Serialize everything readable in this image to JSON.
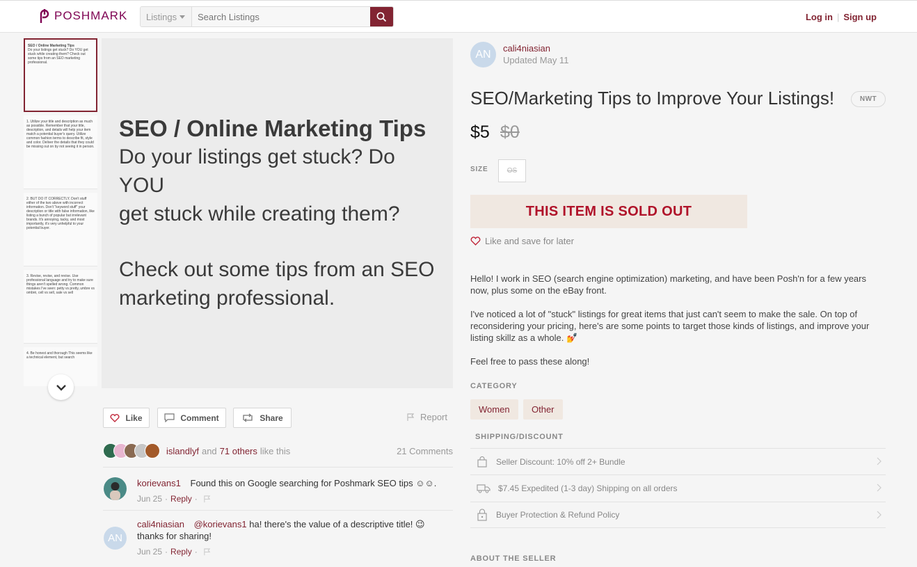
{
  "header": {
    "logo_text": "POSHMARK",
    "search_scope": "Listings",
    "search_placeholder": "Search Listings",
    "login": "Log in",
    "signup": "Sign up",
    "brand_color": "#822432"
  },
  "thumbnails": [
    {
      "title": "SEO / Online Marketing Tips",
      "text": "Do your listings get stuck? Do YOU get stuck while creating them? Check out some tips from an SEO marketing professional."
    },
    {
      "title": "",
      "text": "1. Utilize your title and description as much as possible. Remember that your title, description, and details will help your item match a potential buyer's query. Utilize common fashion terms to describe fit, style and color. Deliver the details that they could be missing out on by not seeing it in person."
    },
    {
      "title": "",
      "text": "2. BUT DO IT CORRECTLY. Don't stuff either of the two above with incorrect information. Don't \"keyword stuff\" your description or title with false information, like listing a bunch of popular but irrelevant brands. It's annoying, tacky, and most importantly, it's very unhelpful to your potential buyer."
    },
    {
      "title": "",
      "text": "3. Revise, revise, and revise. Use professional language and try to make sure things aren't spelled wrong. Common mistakes I've seen: petty vs pretty, umbre vs ombré, cell vs sell, sale vs sell"
    },
    {
      "title": "",
      "text": "4. Be honest and thorough This seems like a technical element, but search"
    }
  ],
  "main_image": {
    "title": "SEO / Online Marketing Tips",
    "line1": "Do your listings get stuck? Do YOU",
    "line2": "get stuck while creating them?",
    "line3": "Check out some tips from an SEO",
    "line4": "marketing professional."
  },
  "actions": {
    "like": "Like",
    "comment": "Comment",
    "share": "Share",
    "report": "Report"
  },
  "likes": {
    "liker": "islandlyf",
    "and": "and",
    "others": "71 others",
    "suffix": "like this",
    "comments_count": "21 Comments"
  },
  "comments": [
    {
      "user": "korievans1",
      "text": "Found this on Google searching for Poshmark SEO tips ☺☺.",
      "date": "Jun 25",
      "reply": "Reply"
    },
    {
      "user": "cali4niasian",
      "initials": "AN",
      "mention": "@korievans1",
      "text": " ha! there's the value of a descriptive title! 😉 thanks for sharing!",
      "date": "Jun 25",
      "reply": "Reply"
    }
  ],
  "seller": {
    "initials": "AN",
    "name": "cali4niasian",
    "updated": "Updated May 11"
  },
  "listing": {
    "title": "SEO/Marketing Tips to Improve Your Listings!",
    "condition": "NWT",
    "price": "$5",
    "original_price": "$0",
    "size_label": "SIZE",
    "size": "OS",
    "sold_out": "THIS ITEM IS SOLD OUT",
    "like_save": "Like and save for later",
    "description": [
      "Hello! I work in SEO (search engine optimization) marketing, and have been Posh'n for a few years now, plus some on the eBay front.",
      "I've noticed a lot of \"stuck\" listings for great items that just can't seem to make the sale. On top of reconsidering your pricing, here's are some points to target those kinds of listings, and improve your listing skillz as a whole. 💅",
      "Feel free to pass these along!"
    ],
    "category_label": "CATEGORY",
    "categories": [
      "Women",
      "Other"
    ],
    "shipping_label": "SHIPPING/DISCOUNT",
    "shipping_rows": [
      {
        "icon": "bag-icon",
        "text": "Seller Discount: 10% off 2+ Bundle"
      },
      {
        "icon": "truck-icon",
        "text": "$7.45 Expedited (1-3 day) Shipping on all orders"
      },
      {
        "icon": "lock-icon",
        "text": "Buyer Protection & Refund Policy"
      }
    ],
    "about_label": "ABOUT THE SELLER"
  }
}
